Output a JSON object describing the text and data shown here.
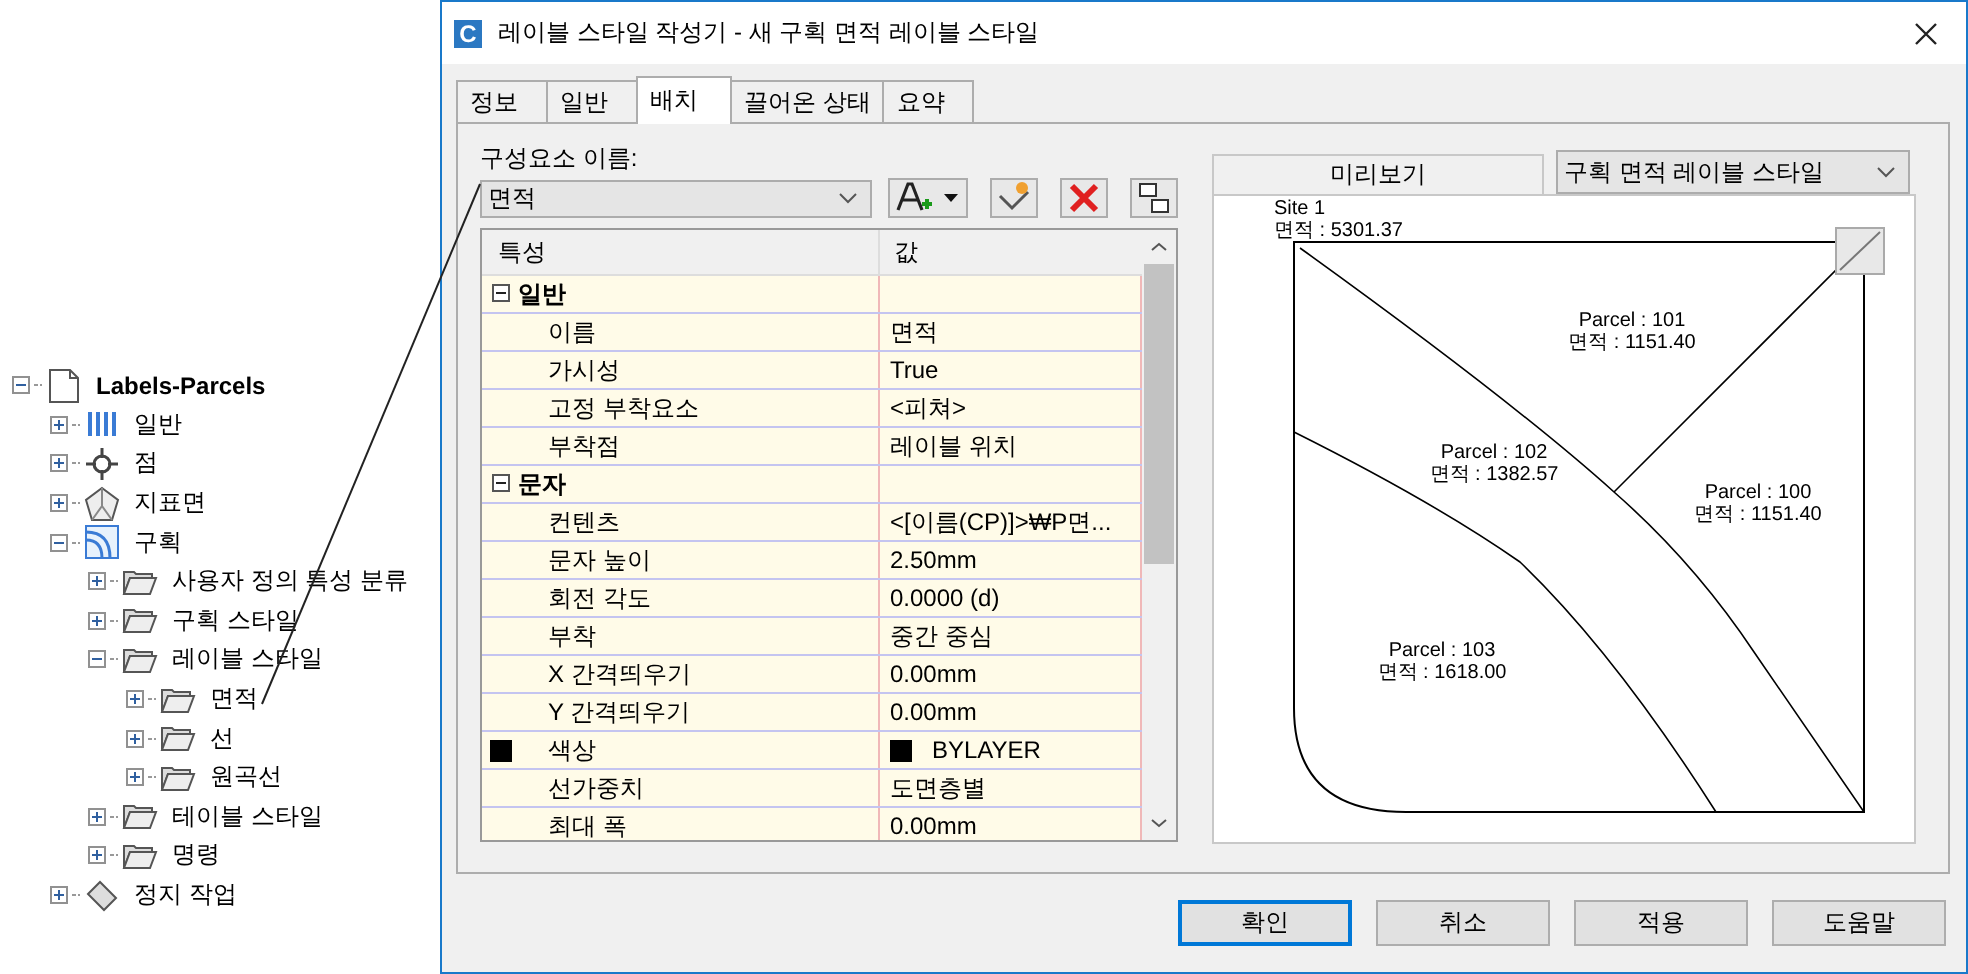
{
  "tree": {
    "label": "Labels-Parcels",
    "kind": "document",
    "expanded": true,
    "children": [
      {
        "label": "일반",
        "kind": "general",
        "expanded": false
      },
      {
        "label": "점",
        "kind": "point",
        "expanded": false
      },
      {
        "label": "지표면",
        "kind": "surface",
        "expanded": false
      },
      {
        "label": "구획",
        "kind": "parcel",
        "expanded": true,
        "children": [
          {
            "label": "사용자 정의 특성 분류",
            "kind": "folder",
            "expanded": false
          },
          {
            "label": "구획 스타일",
            "kind": "folder",
            "expanded": false
          },
          {
            "label": "레이블 스타일",
            "kind": "folder",
            "expanded": true,
            "children": [
              {
                "label": "면적",
                "kind": "folder",
                "expanded": false
              },
              {
                "label": "선",
                "kind": "folder",
                "expanded": false
              },
              {
                "label": "원곡선",
                "kind": "folder",
                "expanded": false
              }
            ]
          },
          {
            "label": "테이블 스타일",
            "kind": "folder",
            "expanded": false
          },
          {
            "label": "명령",
            "kind": "folder",
            "expanded": false
          }
        ]
      },
      {
        "label": "정지 작업",
        "kind": "stop",
        "expanded": false
      }
    ]
  },
  "window": {
    "icon_letter": "C",
    "title": "레이블 스타일 작성기 - 새 구획 면적 레이블 스타일"
  },
  "tabs": [
    {
      "label": "정보",
      "selected": false
    },
    {
      "label": "일반",
      "selected": false
    },
    {
      "label": "배치",
      "selected": true
    },
    {
      "label": "끌어온 상태",
      "selected": false
    },
    {
      "label": "요약",
      "selected": false
    }
  ],
  "component_label": "구성요소 이름:",
  "component_combo": {
    "value": "면적"
  },
  "grid": {
    "columns": [
      "특성",
      "값"
    ],
    "groups": [
      {
        "title": "일반",
        "expanded": true,
        "rows": [
          {
            "name": "이름",
            "value": "면적"
          },
          {
            "name": "가시성",
            "value": "True"
          },
          {
            "name": "고정 부착요소",
            "value": "<피쳐>"
          },
          {
            "name": "부착점",
            "value": "레이블 위치"
          }
        ]
      },
      {
        "title": "문자",
        "expanded": true,
        "rows": [
          {
            "name": "컨텐츠",
            "value": "<[이름(CP)]>₩P면..."
          },
          {
            "name": "문자 높이",
            "value": "2.50mm"
          },
          {
            "name": "회전 각도",
            "value": "0.0000 (d)"
          },
          {
            "name": "부착",
            "value": "중간 중심"
          },
          {
            "name": "X 간격띄우기",
            "value": "0.00mm"
          },
          {
            "name": "Y 간격띄우기",
            "value": "0.00mm"
          },
          {
            "name": "색상",
            "value": "BYLAYER",
            "color": "#000000"
          },
          {
            "name": "선가중치",
            "value": "도면층별"
          },
          {
            "name": "최대 폭",
            "value": "0.00mm"
          }
        ]
      }
    ]
  },
  "preview": {
    "title": "미리보기",
    "style_combo": {
      "value": "구획 면적 레이블 스타일"
    },
    "labels": [
      {
        "name": "Site 1",
        "area": "면적 : 5301.37"
      },
      {
        "name": "Parcel : 101",
        "area": "면적 : 1151.40"
      },
      {
        "name": "Parcel : 102",
        "area": "면적 : 1382.57"
      },
      {
        "name": "Parcel : 100",
        "area": "면적 : 1151.40"
      },
      {
        "name": "Parcel : 103",
        "area": "면적 : 1618.00"
      }
    ]
  },
  "buttons": [
    {
      "label": "확인",
      "default": true
    },
    {
      "label": "취소",
      "default": false
    },
    {
      "label": "적용",
      "default": false
    },
    {
      "label": "도움말",
      "default": false
    }
  ]
}
